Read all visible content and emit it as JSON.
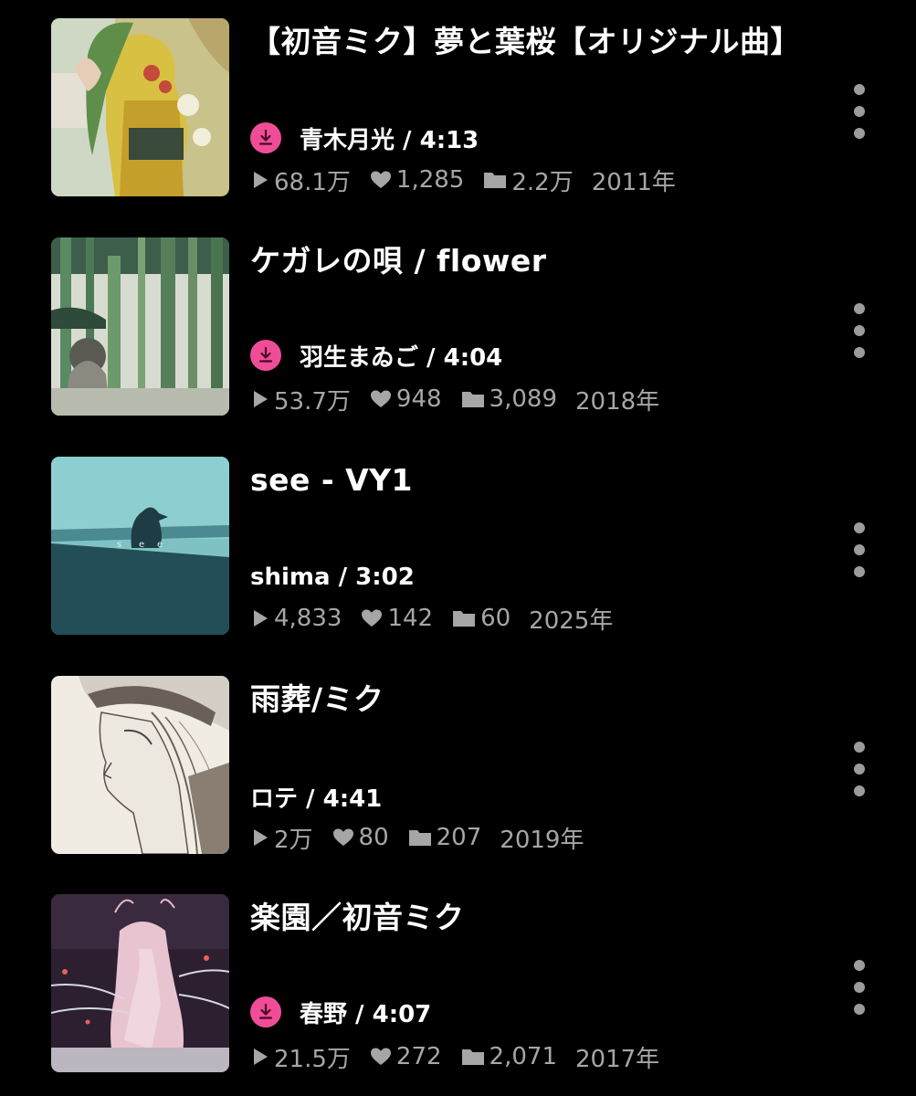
{
  "tracks": [
    {
      "title": "【初音ミク】夢と葉桜【オリジナル曲】",
      "downloaded": true,
      "artist_duration": "青木月光 / 4:13",
      "plays": "68.1万",
      "likes": "1,285",
      "mylists": "2.2万",
      "year": "2011年"
    },
    {
      "title": "ケガレの唄 / flower",
      "downloaded": true,
      "artist_duration": "羽生まゐご / 4:04",
      "plays": "53.7万",
      "likes": "948",
      "mylists": "3,089",
      "year": "2018年"
    },
    {
      "title": "see - VY1",
      "downloaded": false,
      "artist_duration": "shima / 3:02",
      "plays": "4,833",
      "likes": "142",
      "mylists": "60",
      "year": "2025年"
    },
    {
      "title": "雨葬/ミク",
      "downloaded": false,
      "artist_duration": "ロテ / 4:41",
      "plays": "2万",
      "likes": "80",
      "mylists": "207",
      "year": "2019年"
    },
    {
      "title": "楽園／初音ミク",
      "downloaded": true,
      "artist_duration": "春野 / 4:07",
      "plays": "21.5万",
      "likes": "272",
      "mylists": "2,071",
      "year": "2017年"
    }
  ],
  "icons": {
    "download": "download-icon",
    "play": "play-icon",
    "like": "heart-icon",
    "mylist": "folder-icon",
    "more": "more-vertical-icon"
  },
  "colors": {
    "background": "#000000",
    "accent": "#f04d98",
    "title_text": "#ffffff",
    "stat_text": "#a6a6a6"
  }
}
